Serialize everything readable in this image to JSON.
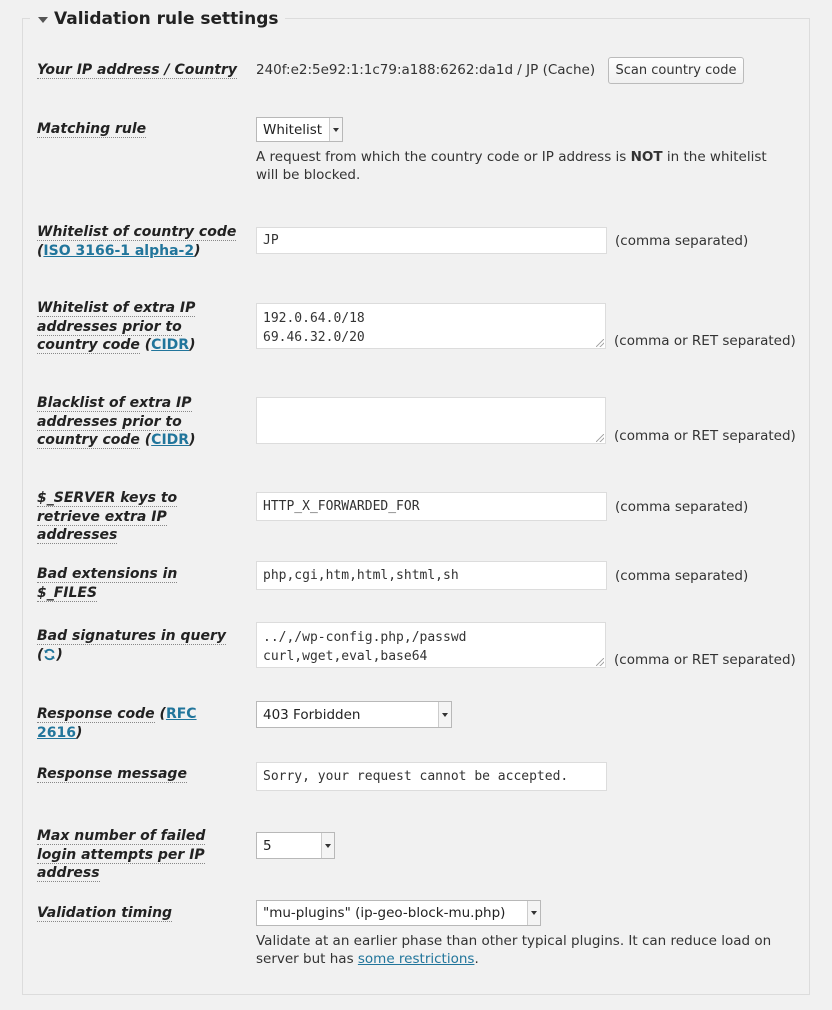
{
  "section": {
    "title": "Validation rule settings"
  },
  "ip_country": {
    "label": "Your IP address / Country",
    "value": "240f:e2:5e92:1:1c79:a188:6262:da1d / JP (Cache)",
    "button": "Scan country code"
  },
  "matching_rule": {
    "label": "Matching rule",
    "selected": "Whitelist",
    "desc_pre": "A request from which the country code or IP address is ",
    "desc_bold": "NOT",
    "desc_post": " in the whitelist will be blocked."
  },
  "whitelist_country": {
    "label": "Whitelist of country code",
    "link": "ISO 3166-1 alpha-2",
    "value": "JP",
    "note": "(comma separated)"
  },
  "whitelist_ip": {
    "label": "Whitelist of extra IP addresses prior to country code",
    "link": "CIDR",
    "value": "192.0.64.0/18\n69.46.32.0/20",
    "note": "(comma or RET separated)"
  },
  "blacklist_ip": {
    "label": "Blacklist of extra IP addresses prior to country code",
    "link": "CIDR",
    "value": "",
    "note": "(comma or RET separated)"
  },
  "server_keys": {
    "label": "$_SERVER keys to retrieve extra IP addresses",
    "value": "HTTP_X_FORWARDED_FOR",
    "note": "(comma separated)"
  },
  "bad_ext": {
    "label": "Bad extensions in $_FILES",
    "value": "php,cgi,htm,html,shtml,sh",
    "note": "(comma separated)"
  },
  "bad_sig": {
    "label": "Bad signatures in query",
    "value": "../,/wp-config.php,/passwd\ncurl,wget,eval,base64",
    "note": "(comma or RET separated)"
  },
  "response_code": {
    "label": "Response code",
    "link": "RFC 2616",
    "selected": "403 Forbidden"
  },
  "response_message": {
    "label": "Response message",
    "value": "Sorry, your request cannot be accepted."
  },
  "max_failed": {
    "label": "Max number of failed login attempts per IP address",
    "selected": "5"
  },
  "validation_timing": {
    "label": "Validation timing",
    "selected": "\"mu-plugins\" (ip-geo-block-mu.php)",
    "desc_pre": "Validate at an earlier phase than other typical plugins. It can reduce load on server but has ",
    "desc_link": "some restrictions",
    "desc_post": "."
  }
}
